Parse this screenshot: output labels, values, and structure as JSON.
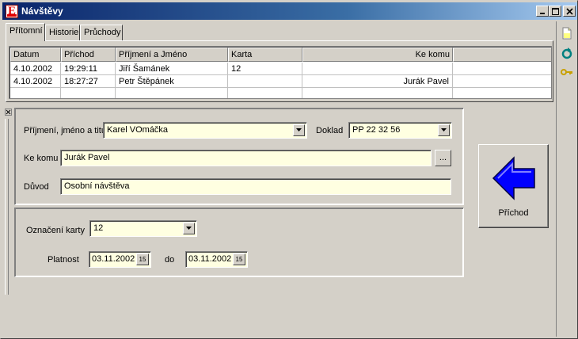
{
  "window": {
    "title": "Návštěvy"
  },
  "tabs": [
    {
      "label": "Přítomní"
    },
    {
      "label": "Historie"
    },
    {
      "label": "Průchody"
    }
  ],
  "grid": {
    "columns": [
      "Datum",
      "Příchod",
      "Příjmení a Jméno",
      "Karta",
      "Ke komu"
    ],
    "rows": [
      [
        "4.10.2002",
        "19:29:11",
        "Jiří Šamánek",
        "12",
        ""
      ],
      [
        "4.10.2002",
        "18:27:27",
        "Petr Štěpánek",
        "",
        "Jurák Pavel"
      ]
    ]
  },
  "form": {
    "name_label": "Příjmení, jméno a titul",
    "name_value": "Karel VOmáčka",
    "doklad_label": "Doklad",
    "doklad_value": "PP 22 32 56",
    "kekomu_label": "Ke komu",
    "kekomu_value": "Jurák Pavel",
    "ellipsis_label": "...",
    "duvod_label": "Důvod",
    "duvod_value": "Osobní návštěva",
    "karta_label": "Označení karty",
    "karta_value": "12",
    "platnost_label": "Platnost",
    "date_from": "03.11.2002",
    "do_label": "do",
    "date_to": "03.11.2002",
    "cal_label": "15"
  },
  "action": {
    "label": "Příchod"
  },
  "icons": {
    "side": [
      "document-icon",
      "refresh-icon",
      "key-icon"
    ],
    "arrow": "left-arrow-icon"
  },
  "colors": {
    "title_start": "#0a246a",
    "title_end": "#a6caf0",
    "field_bg": "#ffffe1",
    "arrow_blue": "#0000ff"
  }
}
